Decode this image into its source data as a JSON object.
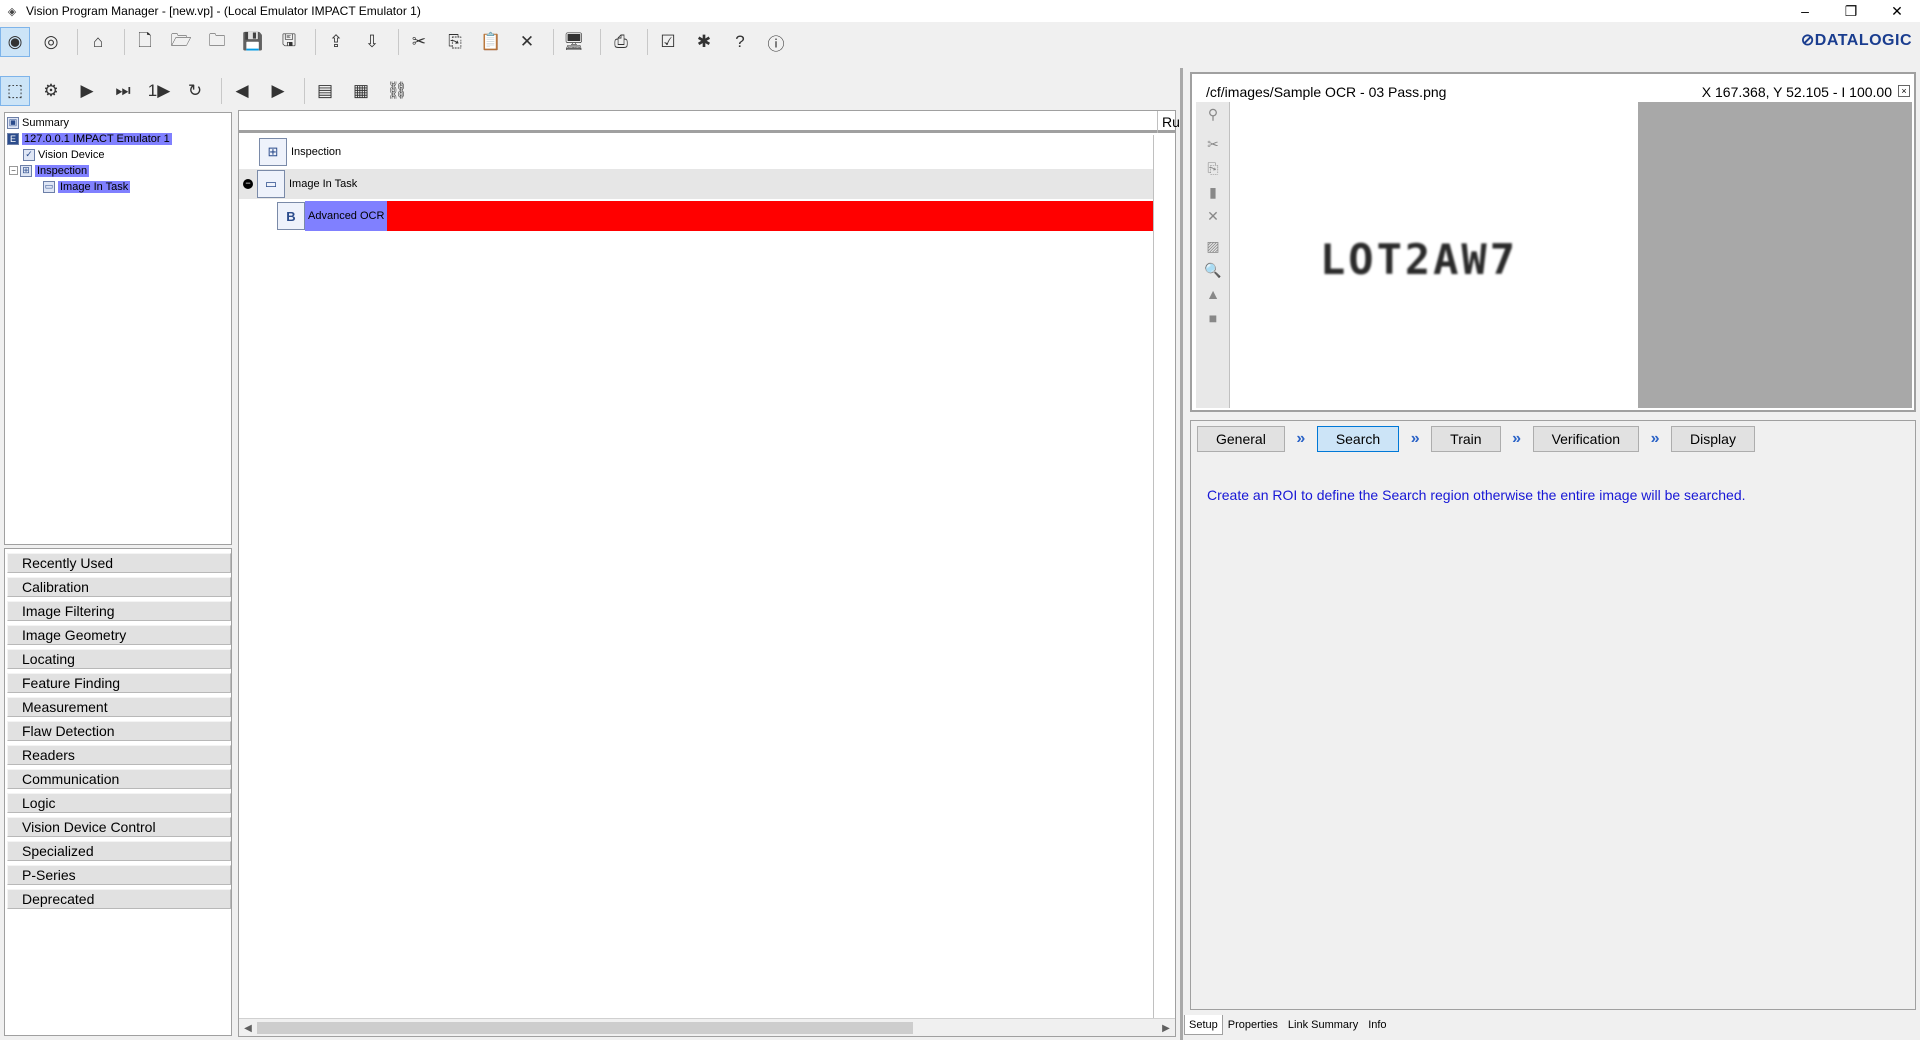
{
  "window": {
    "title": "Vision Program Manager - [new.vp] - (Local Emulator IMPACT Emulator 1)",
    "controls": [
      "–",
      "❐",
      "✕"
    ]
  },
  "brand": "⊘DATALOGIC",
  "toolbar1": {
    "icons": [
      "connect-icon",
      "stop-icon",
      "home-icon",
      "new-file-icon",
      "open-icon",
      "folder-icon",
      "save-icon",
      "save-all-icon",
      "upload-icon",
      "download-icon",
      "cut-icon",
      "copy-icon",
      "paste-icon",
      "delete-icon",
      "monitor-icon",
      "print-icon",
      "checklist-icon",
      "bug-icon",
      "help-icon",
      "about-icon"
    ],
    "glyphs": [
      "◉",
      "◎",
      "⌂",
      "🗋",
      "🗁",
      "🗀",
      "💾",
      "🖫",
      "⇪",
      "⇩",
      "✂",
      "⎘",
      "📋",
      "✕",
      "🖥",
      "⎙",
      "☑",
      "✱",
      "?",
      "ⓘ"
    ]
  },
  "toolbar2": {
    "icons": [
      "edit-mode-icon",
      "settings-icon",
      "run-icon",
      "step-icon",
      "run-once-icon",
      "loop-icon",
      "back-icon",
      "forward-icon",
      "stack-icon",
      "grid-icon",
      "link-icon"
    ],
    "glyphs": [
      "⬚",
      "⚙",
      "▶",
      "⏭",
      "1▶",
      "↻",
      "◀",
      "▶",
      "▤",
      "▦",
      "⛓"
    ]
  },
  "tree": {
    "items": [
      {
        "label": "Summary",
        "glyph": "▣"
      },
      {
        "label": "127.0.0.1 IMPACT Emulator  1",
        "glyph": "E"
      },
      {
        "label": "Vision Device",
        "glyph": "✓"
      },
      {
        "label": "Inspection",
        "glyph": "⊞"
      },
      {
        "label": "Image In Task",
        "glyph": "▭"
      }
    ]
  },
  "categories": [
    "Recently Used",
    "Calibration",
    "Image Filtering",
    "Image Geometry",
    "Locating",
    "Feature Finding",
    "Measurement",
    "Flaw Detection",
    "Readers",
    "Communication",
    "Logic",
    "Vision Device Control",
    "Specialized",
    "P-Series",
    "Deprecated"
  ],
  "center": {
    "column_header": "Ru",
    "rows": [
      {
        "label": "Inspection",
        "glyph": "⊞"
      },
      {
        "label": "Image In Task",
        "glyph": "▭"
      },
      {
        "label": "Advanced OCR",
        "glyph": "B"
      }
    ],
    "error_color": "#ff0000",
    "selection_color": "#8080ff",
    "collapse_glyph": "−"
  },
  "image": {
    "path": "/cf/images/Sample OCR - 03 Pass.png",
    "coords": "X 167.368,  Y 52.105  -  I 100.00",
    "ocr_text": "LOT2AW7",
    "pin_glyph": "×",
    "tools": [
      "roi-icon",
      "cut-icon",
      "copy-icon",
      "paste-icon",
      "delete-icon",
      "overlay-icon",
      "zoom-icon",
      "image-icon",
      "blank-icon"
    ],
    "tool_glyphs": [
      "⚲",
      "✂",
      "⎘",
      "▮",
      "✕",
      "▨",
      "🔍",
      "▲",
      "■"
    ]
  },
  "setup": {
    "steps": [
      "General",
      "Search",
      "Train",
      "Verification",
      "Display"
    ],
    "active_step": "Search",
    "arrow_glyph": "»",
    "hint": "Create an ROI to define the Search region otherwise the entire image will be searched."
  },
  "bottom_tabs": [
    "Setup",
    "Properties",
    "Link Summary",
    "Info"
  ],
  "active_bottom_tab": "Setup"
}
